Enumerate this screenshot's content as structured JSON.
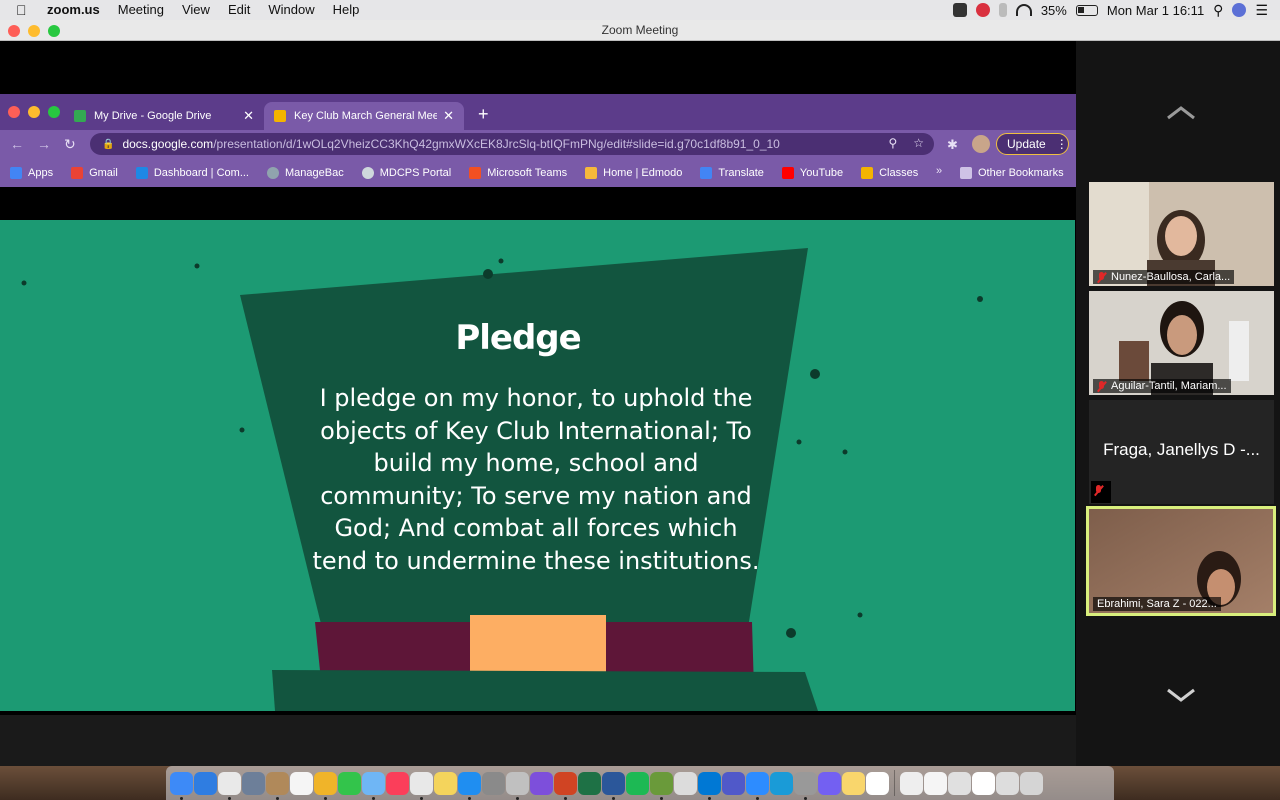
{
  "menubar": {
    "app_name": "zoom.us",
    "items": [
      "Meeting",
      "View",
      "Edit",
      "Window",
      "Help"
    ],
    "battery": "35%",
    "clock": "Mon Mar 1  16:11"
  },
  "zoom_window": {
    "title": "Zoom Meeting"
  },
  "chrome": {
    "tabs": [
      {
        "label": "My Drive - Google Drive",
        "favicon_color": "#f4b400"
      },
      {
        "label": "Key Club March General Meeting",
        "favicon_color": "#f4b400"
      }
    ],
    "new_tab": "+",
    "url_host": "docs.google.com",
    "url_path": "/presentation/d/1wOLq2VheizCC3KhQ42gmxWXcEK8JrcSlq-btIQFmPNg/edit#slide=id.g70c1df8b91_0_10",
    "update_label": "Update",
    "bookmarks": [
      {
        "label": "Apps",
        "color": "#4285f4"
      },
      {
        "label": "Gmail",
        "color": "#ea4335"
      },
      {
        "label": "Dashboard | Com...",
        "color": "#1e88e5"
      },
      {
        "label": "ManageBac",
        "color": "#90a4ae"
      },
      {
        "label": "MDCPS Portal",
        "color": "#cfd8dc"
      },
      {
        "label": "Microsoft Teams",
        "color": "#f25022"
      },
      {
        "label": "Home | Edmodo",
        "color": "#f6b93b"
      },
      {
        "label": "Translate",
        "color": "#4285f4"
      },
      {
        "label": "YouTube",
        "color": "#ff0000"
      },
      {
        "label": "Classes",
        "color": "#f4b400"
      }
    ],
    "bookmarks_more": "»",
    "other_bookmarks": "Other Bookmarks"
  },
  "slide": {
    "title": "Pledge",
    "body": "I pledge on my honor, to uphold the objects of Key Club International; To build my home, school and community; To serve my nation and God; And combat all forces which tend to undermine these institutions."
  },
  "participants": [
    {
      "name": "Nunez-Baullosa, Carla...",
      "cam_bg": "#c9b9a6"
    },
    {
      "name": "Aguilar-Tantil, Mariam...",
      "cam_bg": "#d4d0c8"
    },
    {
      "name": "Fraga, Janellys D -...",
      "cam_bg": ""
    },
    {
      "name": "Ebrahimi, Sara Z - 022...",
      "cam_bg": "#8a6a55"
    }
  ],
  "dock_colors": [
    "#3d8af7",
    "#2f7de1",
    "#e9e9e9",
    "#6d7f99",
    "#b0895a",
    "#f5f5f5",
    "#f0b429",
    "#33c44b",
    "#6fb6f5",
    "#fb3e5a",
    "#e8e8e8",
    "#f4d45c",
    "#1f8ef1",
    "#8a8a8a",
    "#c0c0c0",
    "#7d4fdb",
    "#d04423",
    "#1e7145",
    "#2b579a",
    "#1db954",
    "#6a9a3a",
    "#dcdcdc",
    "#0078d4",
    "#5059c9",
    "#2d8cff",
    "#1a9bd7",
    "#999999",
    "#7360f2",
    "#f9d66c",
    "#ffffff",
    "#eeeeee",
    "#f5f5f5",
    "#e0e0e0",
    "#ffffff",
    "#dddddd",
    "#d5d5d5"
  ]
}
